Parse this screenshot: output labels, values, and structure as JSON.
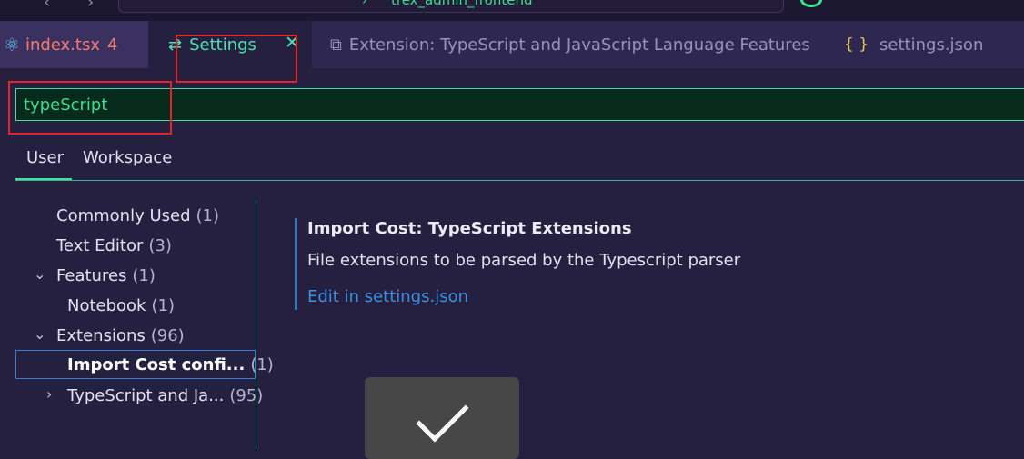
{
  "titlebar": {
    "back_icon": "chevron-left-icon",
    "forward_icon": "chevron-right-icon",
    "command_center_text": "trex_admin_frontend"
  },
  "tabs": [
    {
      "label": "index.tsx",
      "count": "4",
      "icon": "react-icon",
      "color": "#f47b6e"
    },
    {
      "label": "Settings",
      "icon": "settings-icon",
      "active": true,
      "color": "#4de3b0"
    },
    {
      "label": "Extension: TypeScript and JavaScript Language Features",
      "icon": "extensions-icon"
    },
    {
      "label": "settings.json",
      "icon": "json-braces-icon"
    }
  ],
  "search": {
    "value": "typeScript"
  },
  "scope_tabs": {
    "user": "User",
    "workspace": "Workspace"
  },
  "toc": {
    "commonly_used": {
      "label": "Commonly Used",
      "count": "(1)"
    },
    "text_editor": {
      "label": "Text Editor",
      "count": "(3)"
    },
    "features": {
      "label": "Features",
      "count": "(1)"
    },
    "notebook": {
      "label": "Notebook",
      "count": "(1)"
    },
    "extensions": {
      "label": "Extensions",
      "count": "(96)"
    },
    "import_cost": {
      "label": "Import Cost confi...",
      "count": "(1)"
    },
    "typescript": {
      "label": "TypeScript and Ja...",
      "count": "(95)"
    }
  },
  "setting": {
    "title": "Import Cost: TypeScript Extensions",
    "description": "File extensions to be parsed by the Typescript parser",
    "link": "Edit in settings.json"
  },
  "colors": {
    "accent": "#3fe0a0",
    "highlight": "#e52525",
    "link": "#3c8fe0",
    "background": "#262040"
  }
}
